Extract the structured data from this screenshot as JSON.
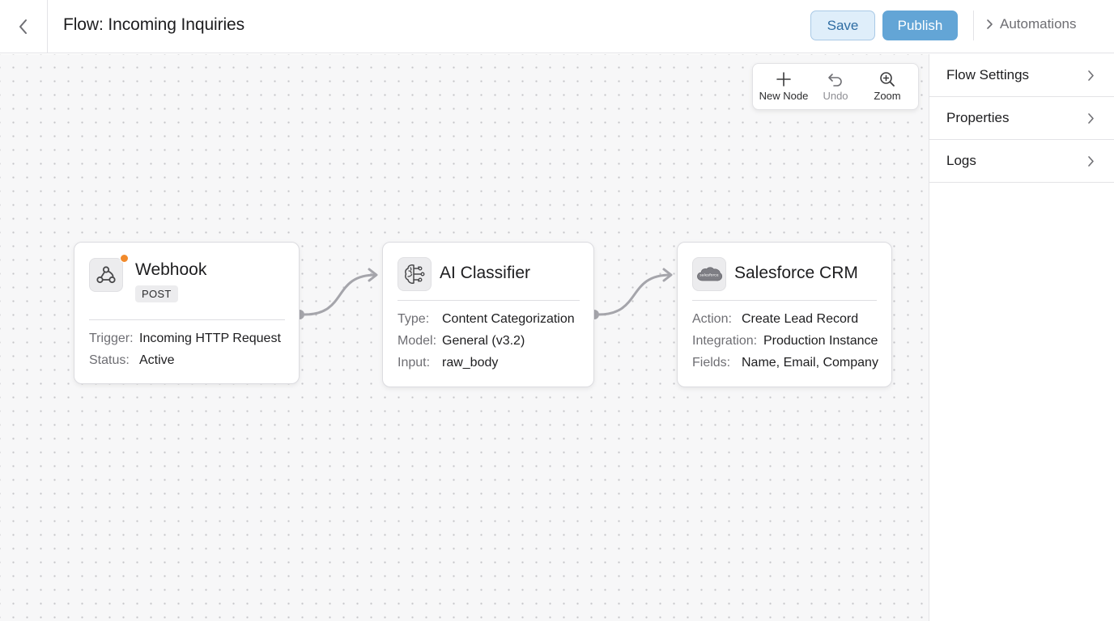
{
  "header": {
    "title": "Flow: Incoming Inquiries",
    "save_label": "Save",
    "publish_label": "Publish",
    "breadcrumb_label": "Automations"
  },
  "toolbar": {
    "new_node": "New Node",
    "undo": "Undo",
    "zoom": "Zoom"
  },
  "nodes": {
    "webhook": {
      "title": "Webhook",
      "badge": "POST",
      "rows": [
        {
          "key": "Trigger:",
          "value": "Incoming HTTP Request"
        },
        {
          "key": "Status:",
          "value": "Active"
        }
      ]
    },
    "classifier": {
      "title": "AI Classifier",
      "rows": [
        {
          "key": "Type:",
          "value": "Content Categorization"
        },
        {
          "key": "Model:",
          "value": "General (v3.2)"
        },
        {
          "key": "Input:",
          "value": "raw_body"
        }
      ]
    },
    "crm": {
      "title": "Salesforce CRM",
      "logo_text": "salesforce",
      "rows": [
        {
          "key": "Action:",
          "value": "Create Lead Record"
        },
        {
          "key": "Integration:",
          "value": "Production Instance"
        },
        {
          "key": "Fields:",
          "value": "Name, Email, Company"
        }
      ]
    }
  },
  "panel": {
    "items": [
      {
        "label": "Flow Settings"
      },
      {
        "label": "Properties"
      },
      {
        "label": "Logs"
      }
    ]
  },
  "colors": {
    "accent": "#63a5d6",
    "status_dot": "#f18a2c",
    "connector": "#a5a5ab"
  }
}
